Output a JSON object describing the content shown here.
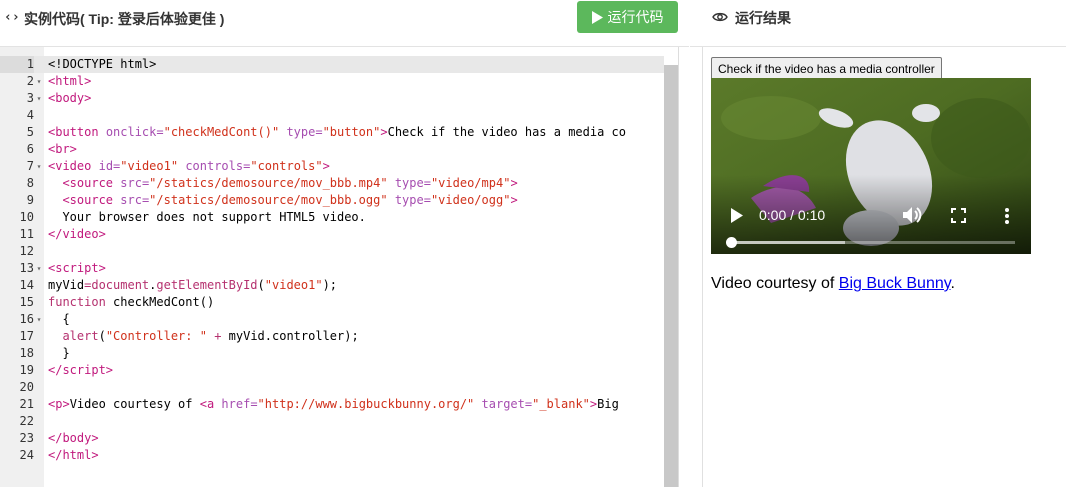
{
  "header": {
    "code_icon": "‹›",
    "title": "实例代码( Tip: 登录后体验更佳 )",
    "run_button_label": "运行代码",
    "result_title": "运行结果"
  },
  "editor": {
    "active_line": 1,
    "lines": [
      {
        "n": "1",
        "fold": "",
        "html": "&lt;!DOCTYPE html&gt;"
      },
      {
        "n": "2",
        "fold": "▾",
        "html": "<span class='tag'>&lt;html&gt;</span>"
      },
      {
        "n": "3",
        "fold": "▾",
        "html": "<span class='tag'>&lt;body&gt;</span>"
      },
      {
        "n": "4",
        "fold": "",
        "html": ""
      },
      {
        "n": "5",
        "fold": "",
        "html": "<span class='tag'>&lt;button</span> <span class='a'>onclick=</span><span class='s'>\"checkMedCont()\"</span> <span class='a'>type=</span><span class='s'>\"button\"</span><span class='tag'>&gt;</span>Check if the video has a media co"
      },
      {
        "n": "6",
        "fold": "",
        "html": "<span class='tag'>&lt;br&gt;</span>"
      },
      {
        "n": "7",
        "fold": "▾",
        "html": "<span class='tag'>&lt;video</span> <span class='a'>id=</span><span class='s'>\"video1\"</span> <span class='a'>controls=</span><span class='s'>\"controls\"</span><span class='tag'>&gt;</span>"
      },
      {
        "n": "8",
        "fold": "",
        "html": "  <span class='tag'>&lt;source</span> <span class='a'>src=</span><span class='s'>\"/statics/demosource/mov_bbb.mp4\"</span> <span class='a'>type=</span><span class='s'>\"video/mp4\"</span><span class='tag'>&gt;</span>"
      },
      {
        "n": "9",
        "fold": "",
        "html": "  <span class='tag'>&lt;source</span> <span class='a'>src=</span><span class='s'>\"/statics/demosource/mov_bbb.ogg\"</span> <span class='a'>type=</span><span class='s'>\"video/ogg\"</span><span class='tag'>&gt;</span>"
      },
      {
        "n": "10",
        "fold": "",
        "html": "  Your browser does not support HTML5 video."
      },
      {
        "n": "11",
        "fold": "",
        "html": "<span class='tag'>&lt;/video&gt;</span>"
      },
      {
        "n": "12",
        "fold": "",
        "html": ""
      },
      {
        "n": "13",
        "fold": "▾",
        "html": "<span class='tag'>&lt;script&gt;</span>"
      },
      {
        "n": "14",
        "fold": "",
        "html": "myVid<span class='k'>=</span><span class='k'>document</span>.<span class='k'>getElementById</span>(<span class='s'>\"video1\"</span>);"
      },
      {
        "n": "15",
        "fold": "",
        "html": "<span class='k'>function</span> checkMedCont()"
      },
      {
        "n": "16",
        "fold": "▾",
        "html": "  {"
      },
      {
        "n": "17",
        "fold": "",
        "html": "  <span class='k'>alert</span>(<span class='s'>\"Controller: \"</span> <span class='k'>+</span> myVid.controller);"
      },
      {
        "n": "18",
        "fold": "",
        "html": "  }"
      },
      {
        "n": "19",
        "fold": "",
        "html": "<span class='tag'>&lt;/script&gt;</span>"
      },
      {
        "n": "20",
        "fold": "",
        "html": ""
      },
      {
        "n": "21",
        "fold": "",
        "html": "<span class='tag'>&lt;p&gt;</span>Video courtesy of <span class='tag'>&lt;a</span> <span class='a'>href=</span><span class='s'>\"http://www.bigbuckbunny.org/\"</span> <span class='a'>target=</span><span class='s'>\"_blank\"</span><span class='tag'>&gt;</span>Big"
      },
      {
        "n": "22",
        "fold": "",
        "html": ""
      },
      {
        "n": "23",
        "fold": "",
        "html": "<span class='tag'>&lt;/body&gt;</span>"
      },
      {
        "n": "24",
        "fold": "",
        "html": "<span class='tag'>&lt;/html&gt;</span>"
      }
    ]
  },
  "preview": {
    "check_button_label": "Check if the video has a media controller",
    "video_time": "0:00 / 0:10",
    "video_progress_fraction": 0.4,
    "courtesy_prefix": "Video courtesy of ",
    "courtesy_link": "Big Buck Bunny",
    "courtesy_suffix": "."
  },
  "colors": {
    "run_button": "#5cb85c",
    "link": "#0000ee",
    "tag": "#c1197d",
    "string": "#d0311b"
  }
}
